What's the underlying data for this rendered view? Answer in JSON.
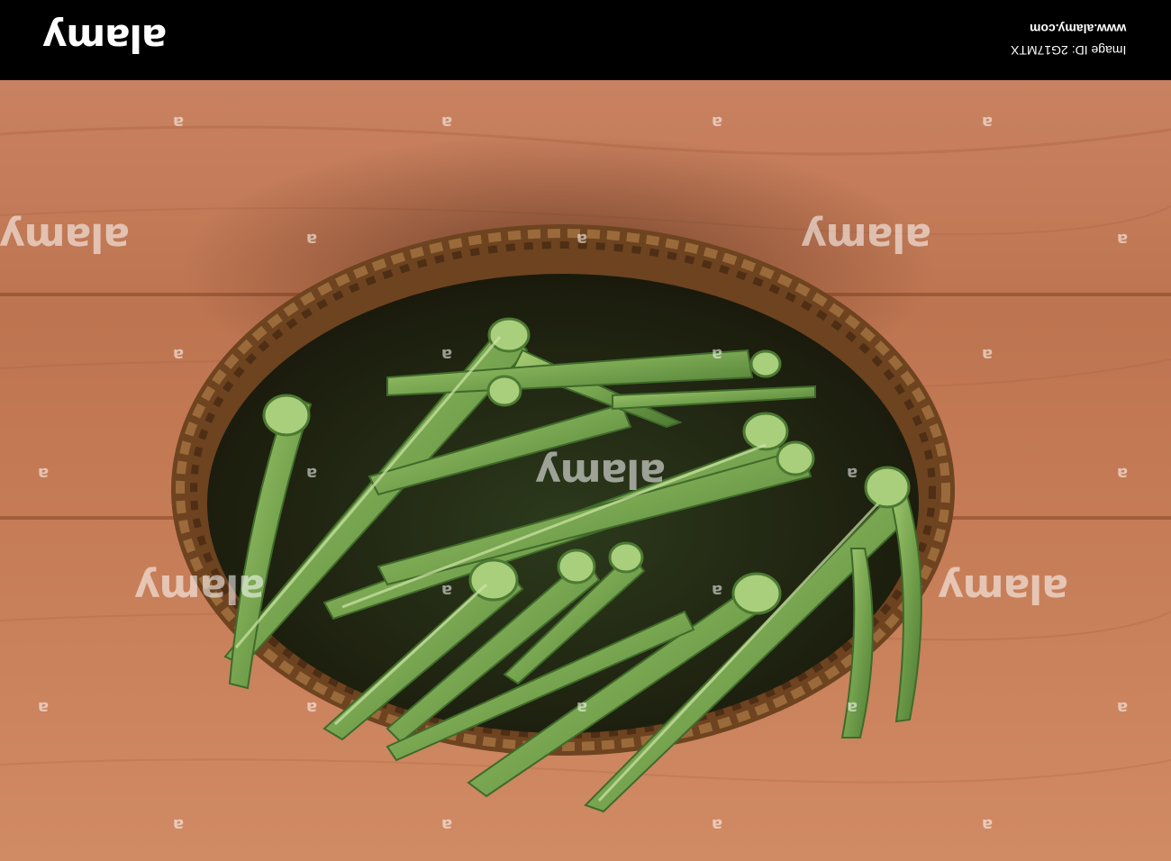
{
  "watermark": {
    "logo_text": "alamy",
    "site_text": "www.alamy.com",
    "image_id_text": "Image ID: 2G17MTX",
    "repeat_small": "a",
    "repeat_big": "alamy"
  },
  "scene": {
    "subject": "okra-pods",
    "container": "wicker-basket",
    "surface": "wooden-table",
    "colors": {
      "wood": "#c47a52",
      "wood_light": "#d08a60",
      "wood_dark": "#a8623e",
      "basket": "#6e4320",
      "okra": "#6f9a4a",
      "okra_light": "#9cc26a",
      "okra_dark": "#3f6a2a"
    }
  }
}
